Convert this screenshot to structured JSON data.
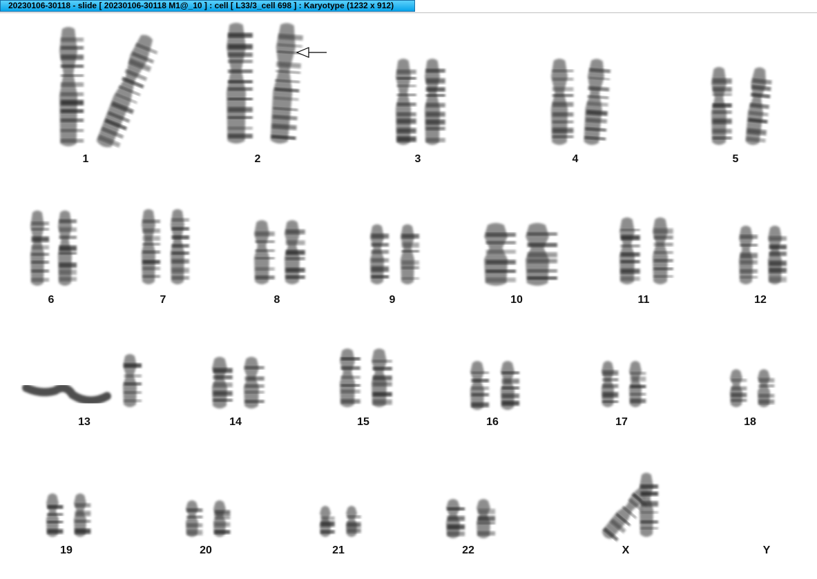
{
  "window": {
    "title": "20230106-30118 - slide [ 20230106-30118 M1@_10 ] : cell [ L33/3_cell 698 ] : Karyotype  (1232 x 912)"
  },
  "colors": {
    "titlebar_top": "#5bd1fb",
    "titlebar_bottom": "#08a3ea",
    "chromosome": "#7a7a7a",
    "band": "#222222"
  },
  "karyotype": {
    "chromosomes": [
      {
        "label": "1"
      },
      {
        "label": "2",
        "annotation": "arrow-icon"
      },
      {
        "label": "3"
      },
      {
        "label": "4"
      },
      {
        "label": "5"
      },
      {
        "label": "6"
      },
      {
        "label": "7"
      },
      {
        "label": "8"
      },
      {
        "label": "9"
      },
      {
        "label": "10"
      },
      {
        "label": "11"
      },
      {
        "label": "12"
      },
      {
        "label": "13"
      },
      {
        "label": "14"
      },
      {
        "label": "15"
      },
      {
        "label": "16"
      },
      {
        "label": "17"
      },
      {
        "label": "18"
      },
      {
        "label": "19"
      },
      {
        "label": "20"
      },
      {
        "label": "21"
      },
      {
        "label": "22"
      },
      {
        "label": "X"
      },
      {
        "label": "Y"
      }
    ]
  }
}
